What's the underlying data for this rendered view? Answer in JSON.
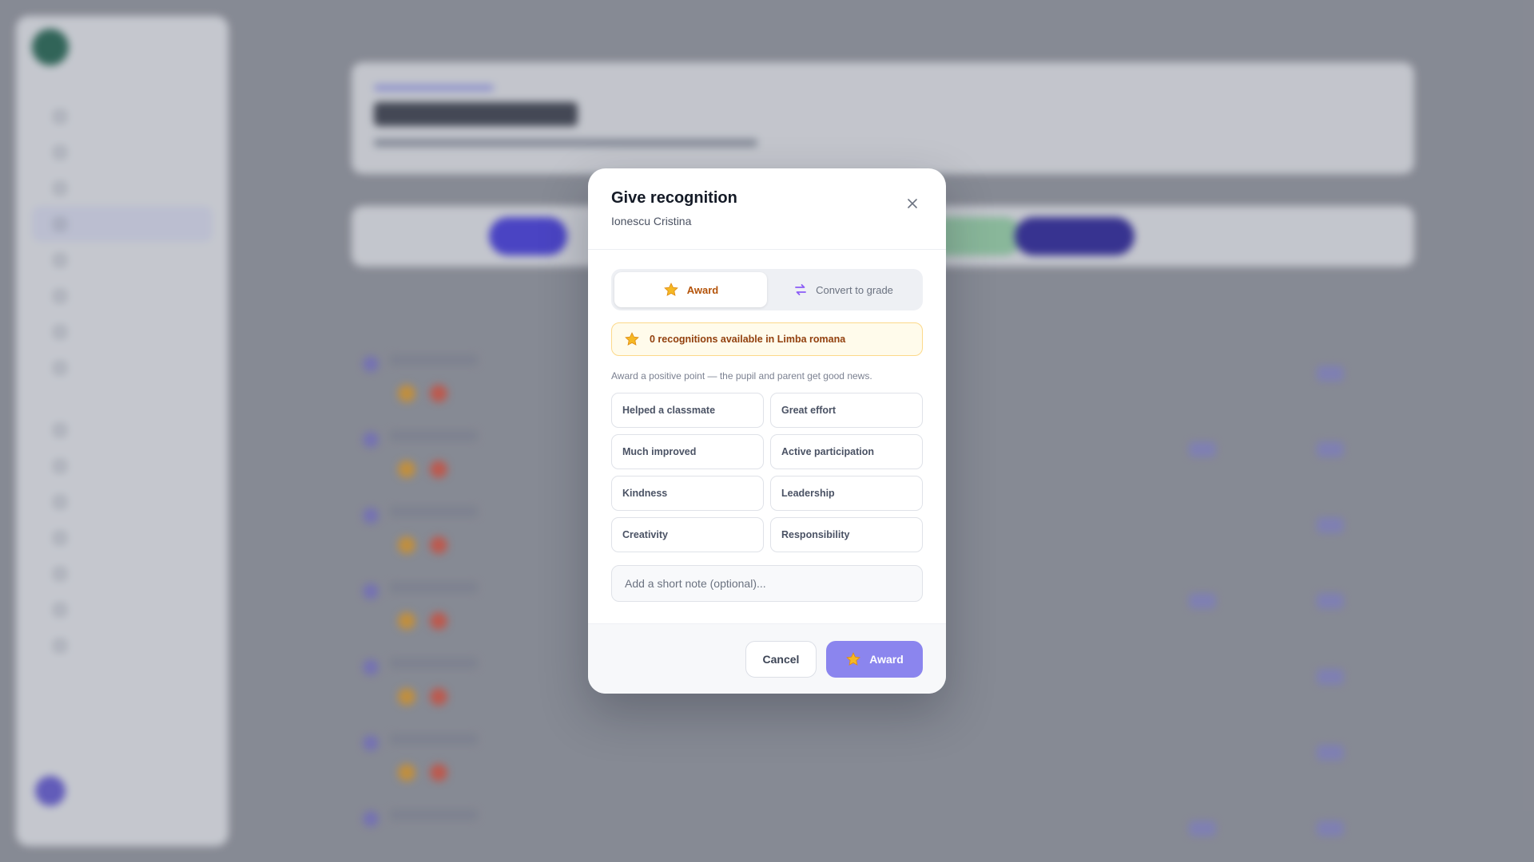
{
  "modal": {
    "title": "Give recognition",
    "subtitle": "Ionescu Cristina",
    "tabs": [
      {
        "label": "Award",
        "icon": "star-icon",
        "active": true
      },
      {
        "label": "Convert to grade",
        "icon": "swap-icon",
        "active": false
      }
    ],
    "banner": "0 recognitions available in Limba romana",
    "hint": "Award a positive point — the pupil and parent get good news.",
    "reasons": [
      "Helped a classmate",
      "Great effort",
      "Much improved",
      "Active participation",
      "Kindness",
      "Leadership",
      "Creativity",
      "Responsibility"
    ],
    "note_placeholder": "Add a short note (optional)...",
    "cancel_label": "Cancel",
    "award_label": "Award"
  },
  "colors": {
    "accent": "#8b85ee",
    "award_tab_text": "#b45309",
    "banner_bg": "#fffbeb",
    "banner_text": "#92400e"
  }
}
